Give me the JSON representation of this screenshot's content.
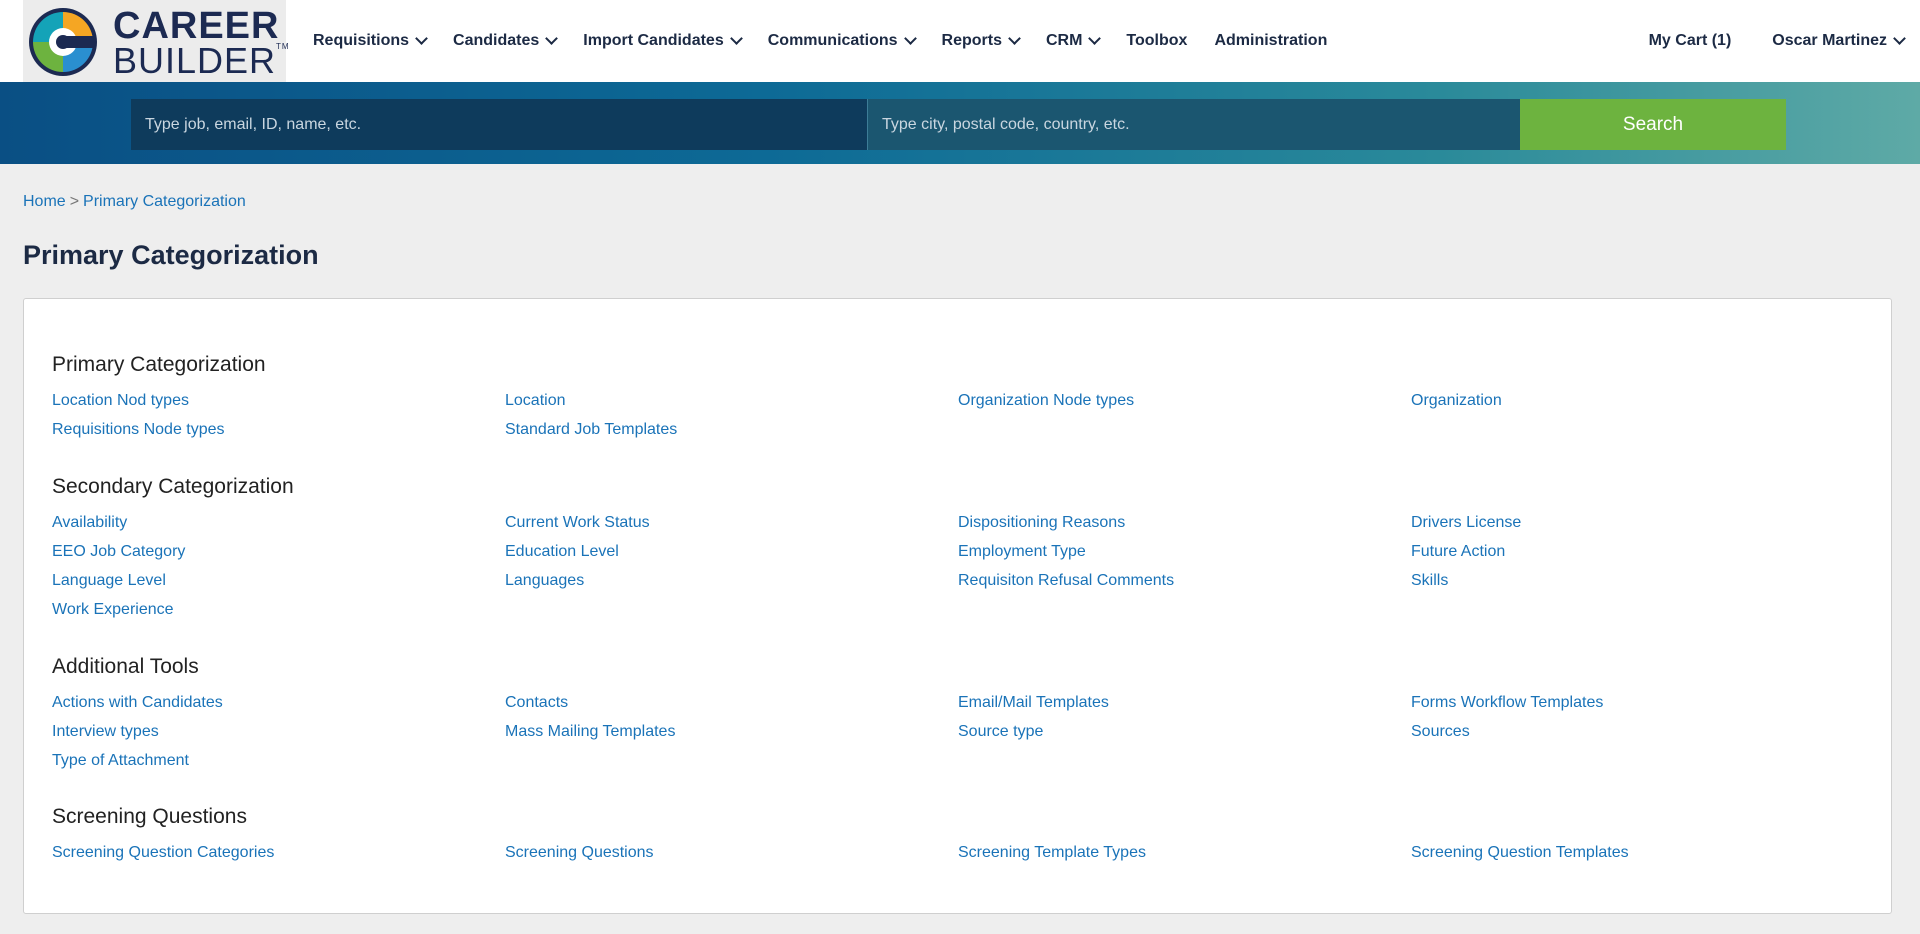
{
  "header": {
    "logo": {
      "line1": "CAREER",
      "line2": "BUILDER",
      "tm": "TM"
    },
    "nav": [
      {
        "label": "Requisitions",
        "dropdown": true
      },
      {
        "label": "Candidates",
        "dropdown": true
      },
      {
        "label": "Import Candidates",
        "dropdown": true
      },
      {
        "label": "Communications",
        "dropdown": true
      },
      {
        "label": "Reports",
        "dropdown": true
      },
      {
        "label": "CRM",
        "dropdown": true
      },
      {
        "label": "Toolbox",
        "dropdown": false
      },
      {
        "label": "Administration",
        "dropdown": false
      }
    ],
    "cart": "My Cart (1)",
    "user": "Oscar Martinez"
  },
  "search": {
    "what_placeholder": "Type job, email, ID, name, etc.",
    "where_placeholder": "Type city, postal code, country, etc.",
    "button": "Search"
  },
  "breadcrumb": {
    "home": "Home",
    "separator": ">",
    "current": "Primary Categorization"
  },
  "page_title": "Primary Categorization",
  "sections": [
    {
      "title": "Primary Categorization",
      "links": [
        "Location Nod types",
        "Location",
        "Organization Node types",
        "Organization",
        "Requisitions Node types",
        "Standard Job Templates"
      ]
    },
    {
      "title": "Secondary Categorization",
      "links": [
        "Availability",
        "Current Work Status",
        "Dispositioning Reasons",
        "Drivers License",
        "EEO Job Category",
        "Education Level",
        "Employment Type",
        "Future Action",
        "Language Level",
        "Languages",
        "Requisiton Refusal Comments",
        "Skills",
        "Work Experience"
      ]
    },
    {
      "title": "Additional Tools",
      "links": [
        "Actions with Candidates",
        "Contacts",
        "Email/Mail Templates",
        "Forms Workflow Templates",
        "Interview types",
        "Mass Mailing Templates",
        "Source type",
        "Sources",
        "Type of Attachment"
      ]
    },
    {
      "title": "Screening Questions",
      "links": [
        "Screening Question Categories",
        "Screening Questions",
        "Screening Template Types",
        "Screening Question Templates"
      ]
    }
  ],
  "colors": {
    "link": "#1a73b8",
    "search_button": "#6db33f",
    "nav_text": "#1c2a44"
  }
}
